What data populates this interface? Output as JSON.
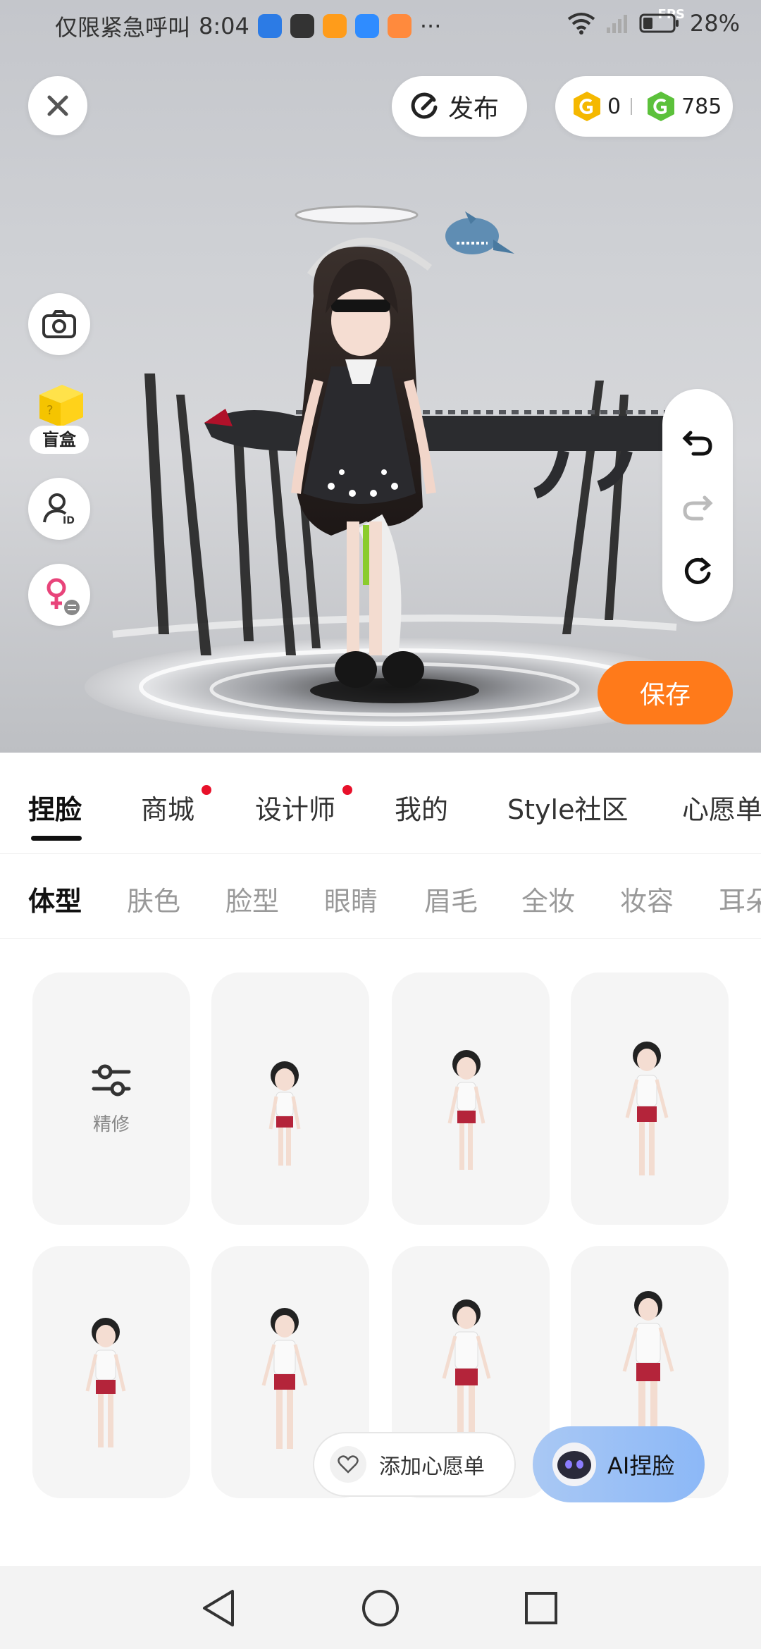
{
  "status_bar": {
    "carrier_text": "仅限紧急呼叫",
    "time": "8:04",
    "more_glyph": "···",
    "battery_percent": "28%",
    "fps_label": "FPS",
    "app_icon_colors": [
      "#2c7be5",
      "#333333",
      "#ff9c1a",
      "#2f8cff",
      "#ff8a3d"
    ]
  },
  "top_bar": {
    "close_icon": "close-icon",
    "publish_label": "发布",
    "coin_gold_value": "0",
    "coin_green_value": "785"
  },
  "left_tools": {
    "camera_icon": "camera-icon",
    "blindbox_label": "盲盒",
    "id_icon": "user-id-icon",
    "gender_icon": "female-swap-icon"
  },
  "right_tools": [
    "undo-icon",
    "redo-icon",
    "reset-icon"
  ],
  "save_label": "保存",
  "main_tabs": [
    {
      "label": "捏脸",
      "active": true,
      "dot": false
    },
    {
      "label": "商城",
      "active": false,
      "dot": true
    },
    {
      "label": "设计师",
      "active": false,
      "dot": true
    },
    {
      "label": "我的",
      "active": false,
      "dot": false
    },
    {
      "label": "Style社区",
      "active": false,
      "dot": false
    },
    {
      "label": "心愿单",
      "active": false,
      "dot": false
    }
  ],
  "sub_tabs": [
    {
      "label": "体型",
      "active": true
    },
    {
      "label": "肤色",
      "active": false
    },
    {
      "label": "脸型",
      "active": false
    },
    {
      "label": "眼睛",
      "active": false
    },
    {
      "label": "眉毛",
      "active": false
    },
    {
      "label": "全妆",
      "active": false
    },
    {
      "label": "妆容",
      "active": false
    },
    {
      "label": "耳朵",
      "active": false
    }
  ],
  "grid": {
    "refine_label": "精修",
    "presets_count_visible": 7
  },
  "wishlist_label": "添加心愿单",
  "ai_face_label": "AI捏脸",
  "colors": {
    "accent_orange": "#ff7a1a",
    "notification_red": "#e8102a",
    "coin_gold": "#f5b800",
    "coin_green": "#5cc13b",
    "ai_button_blue": "#8cb8f7"
  }
}
